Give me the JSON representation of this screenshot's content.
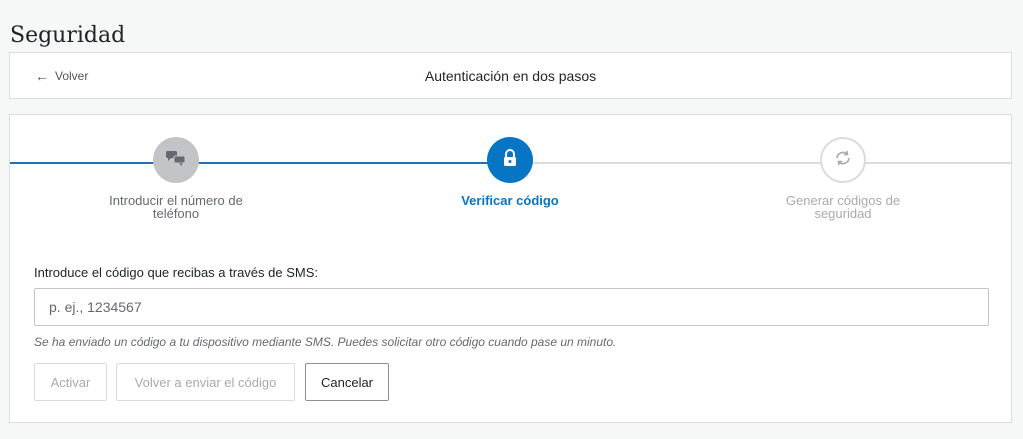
{
  "page": {
    "title": "Seguridad"
  },
  "header": {
    "back_label": "Volver",
    "title": "Autenticación en dos pasos"
  },
  "steps": [
    {
      "label": "Introducir el número de teléfono",
      "status": "done",
      "icon": "chat-bubbles-icon"
    },
    {
      "label": "Verificar código",
      "status": "current",
      "icon": "lock-icon"
    },
    {
      "label": "Generar códigos de seguridad",
      "status": "upcoming",
      "icon": "refresh-icon"
    }
  ],
  "form": {
    "label": "Introduce el código que recibas a través de SMS:",
    "input_value": "",
    "input_placeholder": "p. ej., 1234567",
    "help": "Se ha enviado un código a tu dispositivo mediante SMS. Puedes solicitar otro código cuando pase un minuto."
  },
  "buttons": {
    "activate": "Activar",
    "resend": "Volver a enviar el código",
    "cancel": "Cancelar"
  },
  "colors": {
    "accent": "#0675c4",
    "done_gray": "#c3c4c7",
    "border": "#dcdcde"
  }
}
